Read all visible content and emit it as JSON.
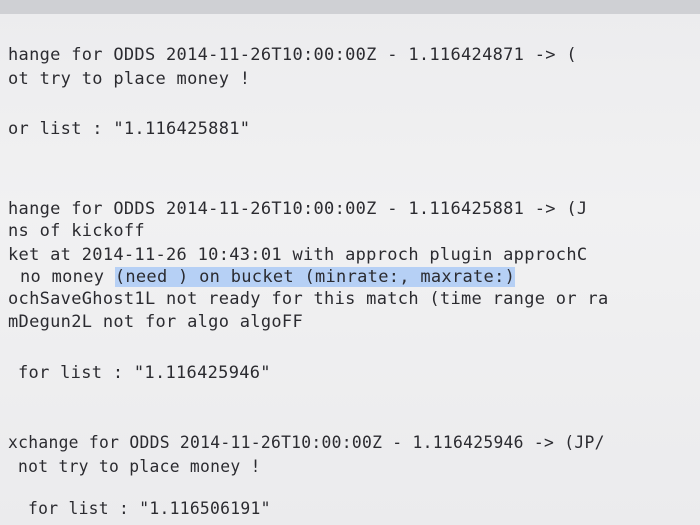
{
  "terminal": {
    "lines": [
      "hange for ODDS 2014-11-26T10:00:00Z - 1.116424871 -> (",
      "ot try to place money !",
      "or list : \"1.116425881\"",
      "hange for ODDS 2014-11-26T10:00:00Z - 1.116425881 -> (J",
      "ns of kickoff",
      "ket at 2014-11-26 10:43:01 with approch plugin approchC",
      "no money ",
      "(need ) on bucket (minrate:, maxrate:)",
      "ochSaveGhost1L not ready for this match (time range or ra",
      "mDegun2L not for algo algoFF",
      "for list : \"1.116425946\"",
      "xchange for ODDS 2014-11-26T10:00:00Z - 1.116425946 -> (JP/",
      "not try to place money !",
      "for list : \"1.116506191\""
    ]
  }
}
